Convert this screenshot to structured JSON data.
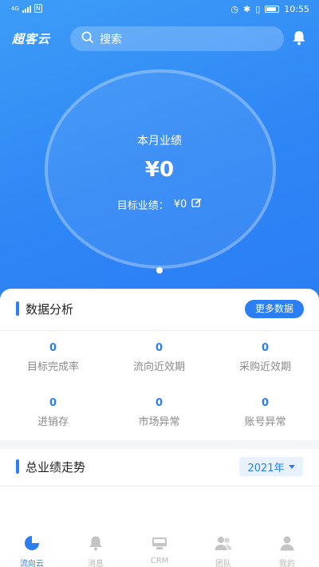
{
  "status_bar": {
    "signal_text": "4G",
    "network_badge": "N",
    "time": "10:55"
  },
  "header": {
    "app_title": "超客云",
    "search_placeholder": "搜索"
  },
  "hero": {
    "month_label": "本月业绩",
    "month_value": "¥0",
    "target_label": "目标业绩：",
    "target_value": "¥0"
  },
  "data_analysis": {
    "title": "数据分析",
    "more_label": "更多数据",
    "metrics": [
      {
        "value": "0",
        "label": "目标完成率"
      },
      {
        "value": "0",
        "label": "流向近效期"
      },
      {
        "value": "0",
        "label": "采购近效期"
      },
      {
        "value": "0",
        "label": "进销存"
      },
      {
        "value": "0",
        "label": "市场异常"
      },
      {
        "value": "0",
        "label": "账号异常"
      }
    ]
  },
  "trend": {
    "title": "总业绩走势",
    "year": "2021年"
  },
  "tabs": [
    {
      "label": "流向云",
      "icon": "pie-chart-icon",
      "active": true
    },
    {
      "label": "消息",
      "icon": "bell-icon",
      "active": false
    },
    {
      "label": "CRM",
      "icon": "monitor-icon",
      "active": false
    },
    {
      "label": "团队",
      "icon": "people-icon",
      "active": false
    },
    {
      "label": "我的",
      "icon": "person-icon",
      "active": false
    }
  ],
  "colors": {
    "primary": "#2b7ef4",
    "hero_start": "#3d9cf7",
    "muted": "#b8b8b8"
  }
}
